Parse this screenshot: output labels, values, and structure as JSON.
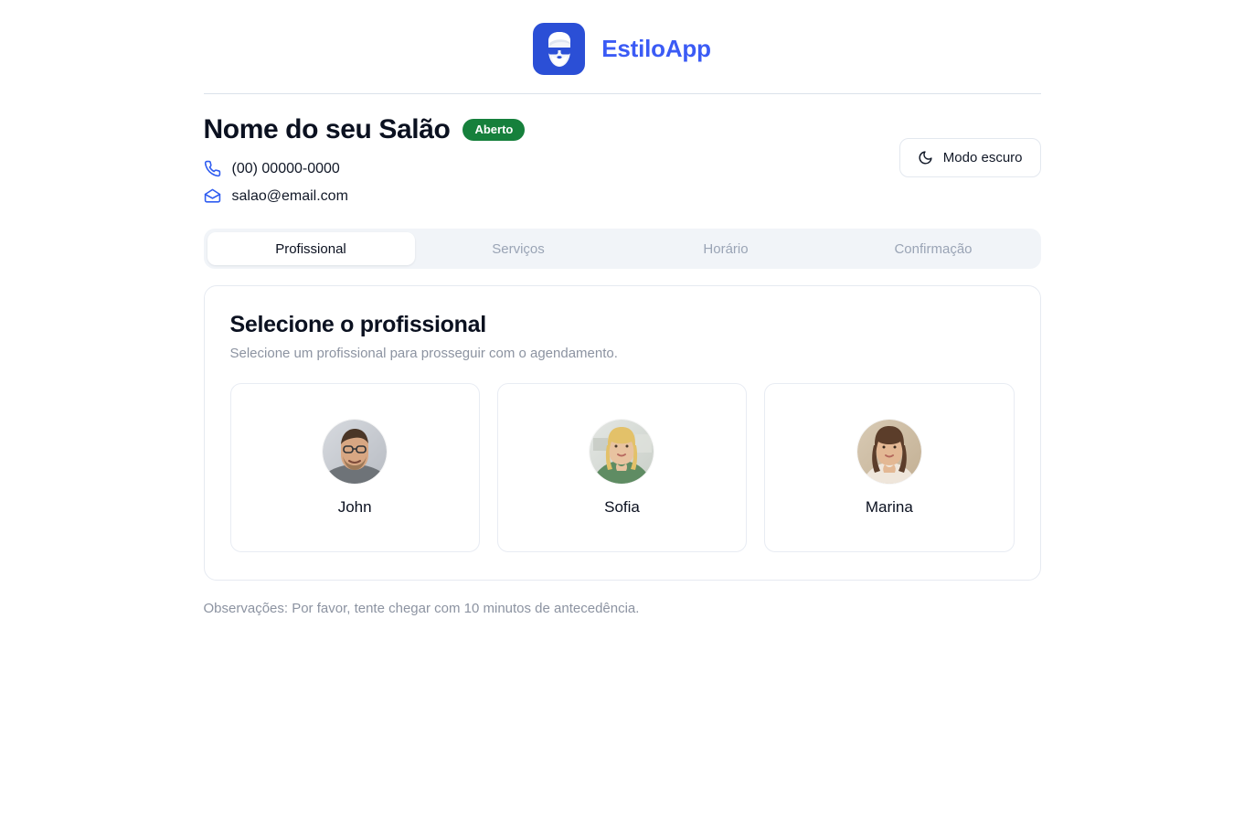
{
  "brand": {
    "name": "EstiloApp",
    "logo_icon": "bearded-man-sunglasses-logo",
    "logo_color": "#2b4fd6",
    "name_color": "#3b5bf5"
  },
  "salon": {
    "title": "Nome do seu Salão",
    "status_badge": "Aberto",
    "status_color": "#16803c",
    "contacts": [
      {
        "icon": "phone-icon",
        "value": "(00) 00000-0000"
      },
      {
        "icon": "envelope-icon",
        "value": "salao@email.com"
      }
    ],
    "icon_color": "#2f5cf0"
  },
  "darkmode": {
    "label": "Modo escuro",
    "icon": "moon-icon"
  },
  "tabs": [
    {
      "label": "Profissional",
      "active": true
    },
    {
      "label": "Serviços",
      "active": false
    },
    {
      "label": "Horário",
      "active": false
    },
    {
      "label": "Confirmação",
      "active": false
    }
  ],
  "panel": {
    "title": "Selecione o profissional",
    "subtitle": "Selecione um profissional para prosseguir com o agendamento.",
    "professionals": [
      {
        "name": "John",
        "avatar": "avatar-man-glasses-beard",
        "bg": "#c9ccd1"
      },
      {
        "name": "Sofia",
        "avatar": "avatar-blonde-woman-green-top",
        "bg": "#d7dbd8"
      },
      {
        "name": "Marina",
        "avatar": "avatar-brunette-woman-beige",
        "bg": "#cdbfab"
      }
    ]
  },
  "footer": {
    "note": "Observações: Por favor, tente chegar com 10 minutos de antecedência."
  }
}
